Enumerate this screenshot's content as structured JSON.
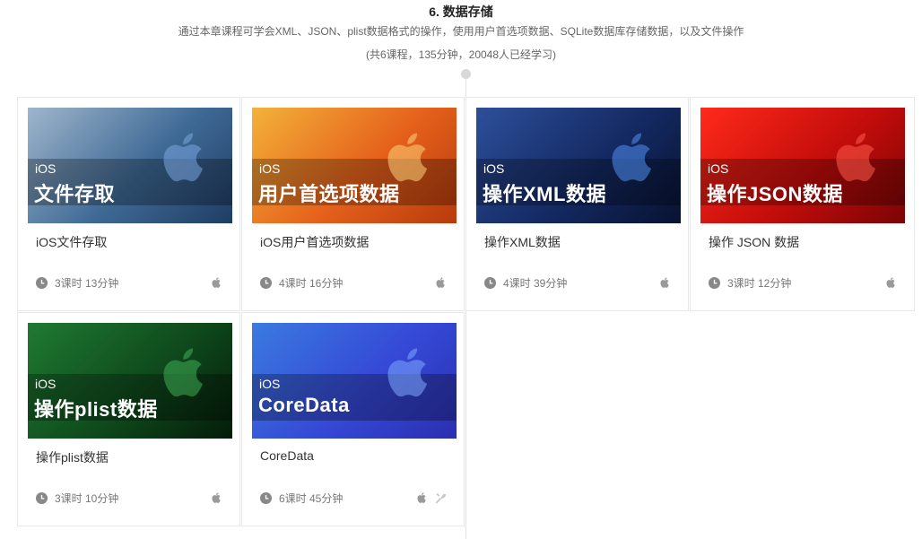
{
  "section": {
    "title": "6. 数据存储",
    "description": "通过本章课程可学会XML、JSON、plist数据格式的操作，使用用户首选项数据、SQLite数据库存储数据，以及文件操作",
    "meta": "(共6课程，135分钟，20048人已经学习)"
  },
  "courses": [
    {
      "thumb_small": "iOS",
      "thumb_big": "文件存取",
      "name": "iOS文件存取",
      "stats": "3课时 13分钟",
      "platform": "apple-icon",
      "colors": [
        "#9fb6cc",
        "#3f6a96",
        "#1f3d63"
      ]
    },
    {
      "thumb_small": "iOS",
      "thumb_big": "用户首选项数据",
      "name": "iOS用户首选项数据",
      "stats": "4课时 16分钟",
      "platform": "apple-icon",
      "colors": [
        "#f4b23a",
        "#e5611b",
        "#b83a0c"
      ]
    },
    {
      "thumb_small": "iOS",
      "thumb_big": "操作XML数据",
      "name": "操作XML数据",
      "stats": "4课时 39分钟",
      "platform": "apple-icon",
      "colors": [
        "#2d4f9a",
        "#142a63",
        "#081231"
      ]
    },
    {
      "thumb_small": "iOS",
      "thumb_big": "操作JSON数据",
      "name": "操作 JSON 数据",
      "stats": "3课时 12分钟",
      "platform": "apple-icon",
      "colors": [
        "#ff2a1a",
        "#c40d0b",
        "#7a0404"
      ]
    },
    {
      "thumb_small": "iOS",
      "thumb_big": "操作plist数据",
      "name": "操作plist数据",
      "stats": "3课时 10分钟",
      "platform": "apple-icon",
      "colors": [
        "#1f7a32",
        "#0f4a1c",
        "#041c09"
      ]
    },
    {
      "thumb_small": "iOS",
      "thumb_big": "CoreData",
      "name": "CoreData",
      "stats": "6课时 45分钟",
      "platform": "apple-icon",
      "extra_icon": "tools-icon",
      "colors": [
        "#3b7ae0",
        "#3549d6",
        "#2a2fb0"
      ]
    }
  ]
}
